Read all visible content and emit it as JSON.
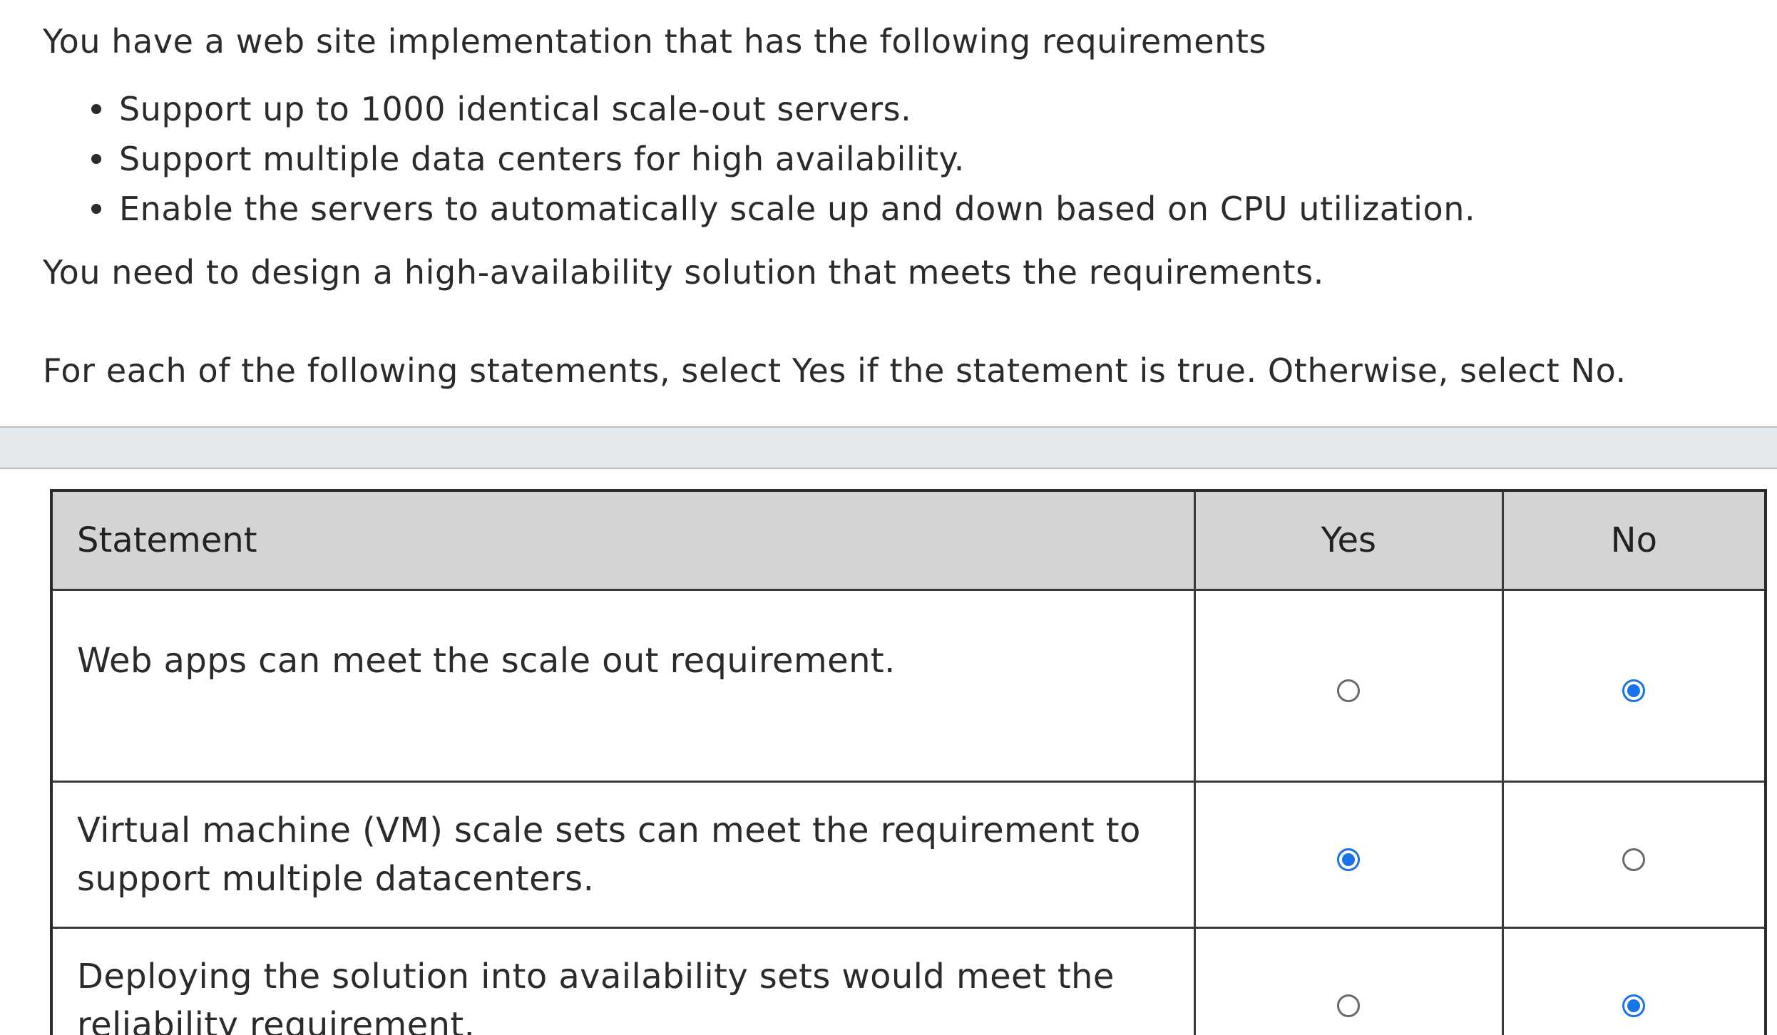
{
  "question": {
    "intro": "You have a web site implementation that has the following requirements",
    "requirements": [
      "Support up to 1000 identical scale-out servers.",
      "Support multiple data centers for high availability.",
      "Enable the servers to automatically scale up and down based on CPU utilization."
    ],
    "need": "You need to design a high-availability solution that meets the requirements.",
    "instruction": "For each of the following statements, select Yes if the statement is true. Otherwise, select No."
  },
  "table": {
    "headers": {
      "statement": "Statement",
      "yes": "Yes",
      "no": "No"
    },
    "rows": [
      {
        "statement": "Web apps can meet the scale out requirement.",
        "selected": "No"
      },
      {
        "statement": "Virtual machine (VM) scale sets can meet the requirement to support multiple datacenters.",
        "selected": "Yes"
      },
      {
        "statement": "Deploying the solution into availability sets would meet the reliability requirement.",
        "selected": "No"
      }
    ]
  },
  "colors": {
    "radio_selected": "#1a73e8",
    "header_bg": "#d4d4d4",
    "band_bg": "#e4e9ee"
  }
}
